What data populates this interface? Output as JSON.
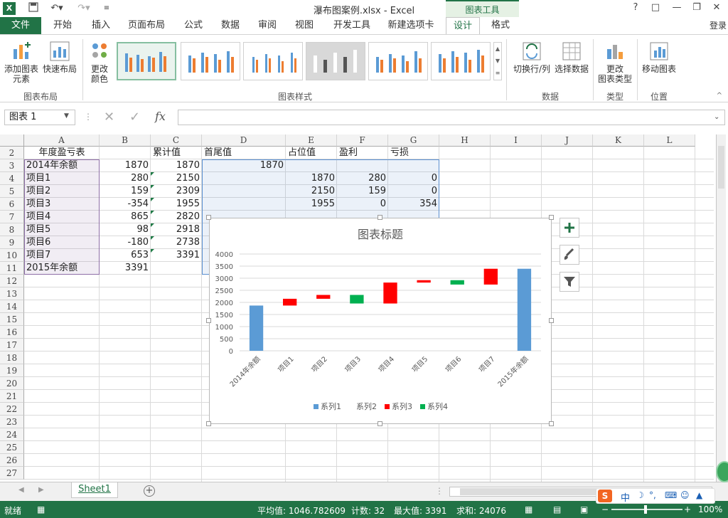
{
  "window": {
    "title": "瀑布图案例.xlsx - Excel",
    "tools_header": "图表工具",
    "help": "?",
    "controls": [
      "□",
      "—",
      "❐",
      "✕"
    ]
  },
  "tabs": {
    "file": "文件",
    "items": [
      "开始",
      "插入",
      "页面布局",
      "公式",
      "数据",
      "审阅",
      "视图",
      "开发工具",
      "新建选项卡",
      "设计",
      "格式"
    ],
    "active": "设计",
    "login": "登录"
  },
  "ribbon": {
    "add_element": "添加图表",
    "add_element2": "元素",
    "quick_layout": "快速布局",
    "change_colors": "更改",
    "change_colors2": "颜色",
    "group_layout": "图表布局",
    "group_styles": "图表样式",
    "switch_row_col": "切换行/列",
    "select_data": "选择数据",
    "group_data": "数据",
    "change_type": "更改",
    "change_type2": "图表类型",
    "group_type": "类型",
    "move_chart": "移动图表",
    "group_location": "位置"
  },
  "formula_bar": {
    "name_box": "图表 1",
    "fx": "fx"
  },
  "sheet": {
    "columns": [
      "A",
      "B",
      "C",
      "D",
      "E",
      "F",
      "G",
      "H",
      "I",
      "J",
      "K",
      "L"
    ],
    "rows": [
      "2",
      "3",
      "4",
      "5",
      "6",
      "7",
      "8",
      "9",
      "10",
      "11",
      "12",
      "13",
      "14",
      "15",
      "16",
      "17",
      "18",
      "19",
      "20",
      "21",
      "22",
      "23",
      "24",
      "25",
      "26",
      "27"
    ],
    "header_row": [
      "年度盈亏表",
      "",
      "累计值",
      "首尾值",
      "占位值",
      "盈利",
      "亏损"
    ],
    "data": [
      [
        "2014年余额",
        "1870",
        "1870",
        "1870",
        "",
        "",
        ""
      ],
      [
        "项目1",
        "280",
        "2150",
        "",
        "1870",
        "280",
        "0"
      ],
      [
        "项目2",
        "159",
        "2309",
        "",
        "2150",
        "159",
        "0"
      ],
      [
        "项目3",
        "-354",
        "1955",
        "",
        "1955",
        "0",
        "354"
      ],
      [
        "项目4",
        "865",
        "2820",
        "",
        "",
        "",
        ""
      ],
      [
        "项目5",
        "98",
        "2918",
        "",
        "",
        "",
        ""
      ],
      [
        "项目6",
        "-180",
        "2738",
        "",
        "",
        "",
        ""
      ],
      [
        "项目7",
        "653",
        "3391",
        "",
        "",
        "",
        ""
      ],
      [
        "2015年余额",
        "3391",
        "",
        "",
        "",
        "",
        ""
      ]
    ]
  },
  "chart_data": {
    "type": "bar",
    "title": "图表标题",
    "categories": [
      "2014年余额",
      "项目1",
      "项目2",
      "项目3",
      "项目4",
      "项目5",
      "项目6",
      "项目7",
      "2015年余额"
    ],
    "series": [
      {
        "name": "系列1",
        "values": [
          1870,
          null,
          null,
          null,
          null,
          null,
          null,
          null,
          3391
        ],
        "color": "#5b9bd5"
      },
      {
        "name": "系列2",
        "values": [
          null,
          1870,
          2150,
          1955,
          1955,
          2820,
          2738,
          2738,
          null
        ],
        "color": "none"
      },
      {
        "name": "系列3",
        "values": [
          null,
          280,
          159,
          null,
          865,
          98,
          null,
          653,
          null
        ],
        "color": "#ff0000"
      },
      {
        "name": "系列4",
        "values": [
          null,
          null,
          null,
          354,
          null,
          null,
          180,
          null,
          null
        ],
        "color": "#00b050"
      }
    ],
    "stacked": true,
    "ylim": [
      0,
      4000
    ],
    "yticks": [
      0,
      500,
      1000,
      1500,
      2000,
      2500,
      3000,
      3500,
      4000
    ],
    "grid": true,
    "legend": "bottom"
  },
  "sheet_tabs": [
    "Sheet1"
  ],
  "status": {
    "mode": "就绪",
    "average": "平均值: 1046.782609",
    "count": "计数: 32",
    "max": "最大值: 3391",
    "sum": "求和: 24076",
    "zoom": "100%"
  },
  "colors": {
    "excel_green": "#217346"
  }
}
